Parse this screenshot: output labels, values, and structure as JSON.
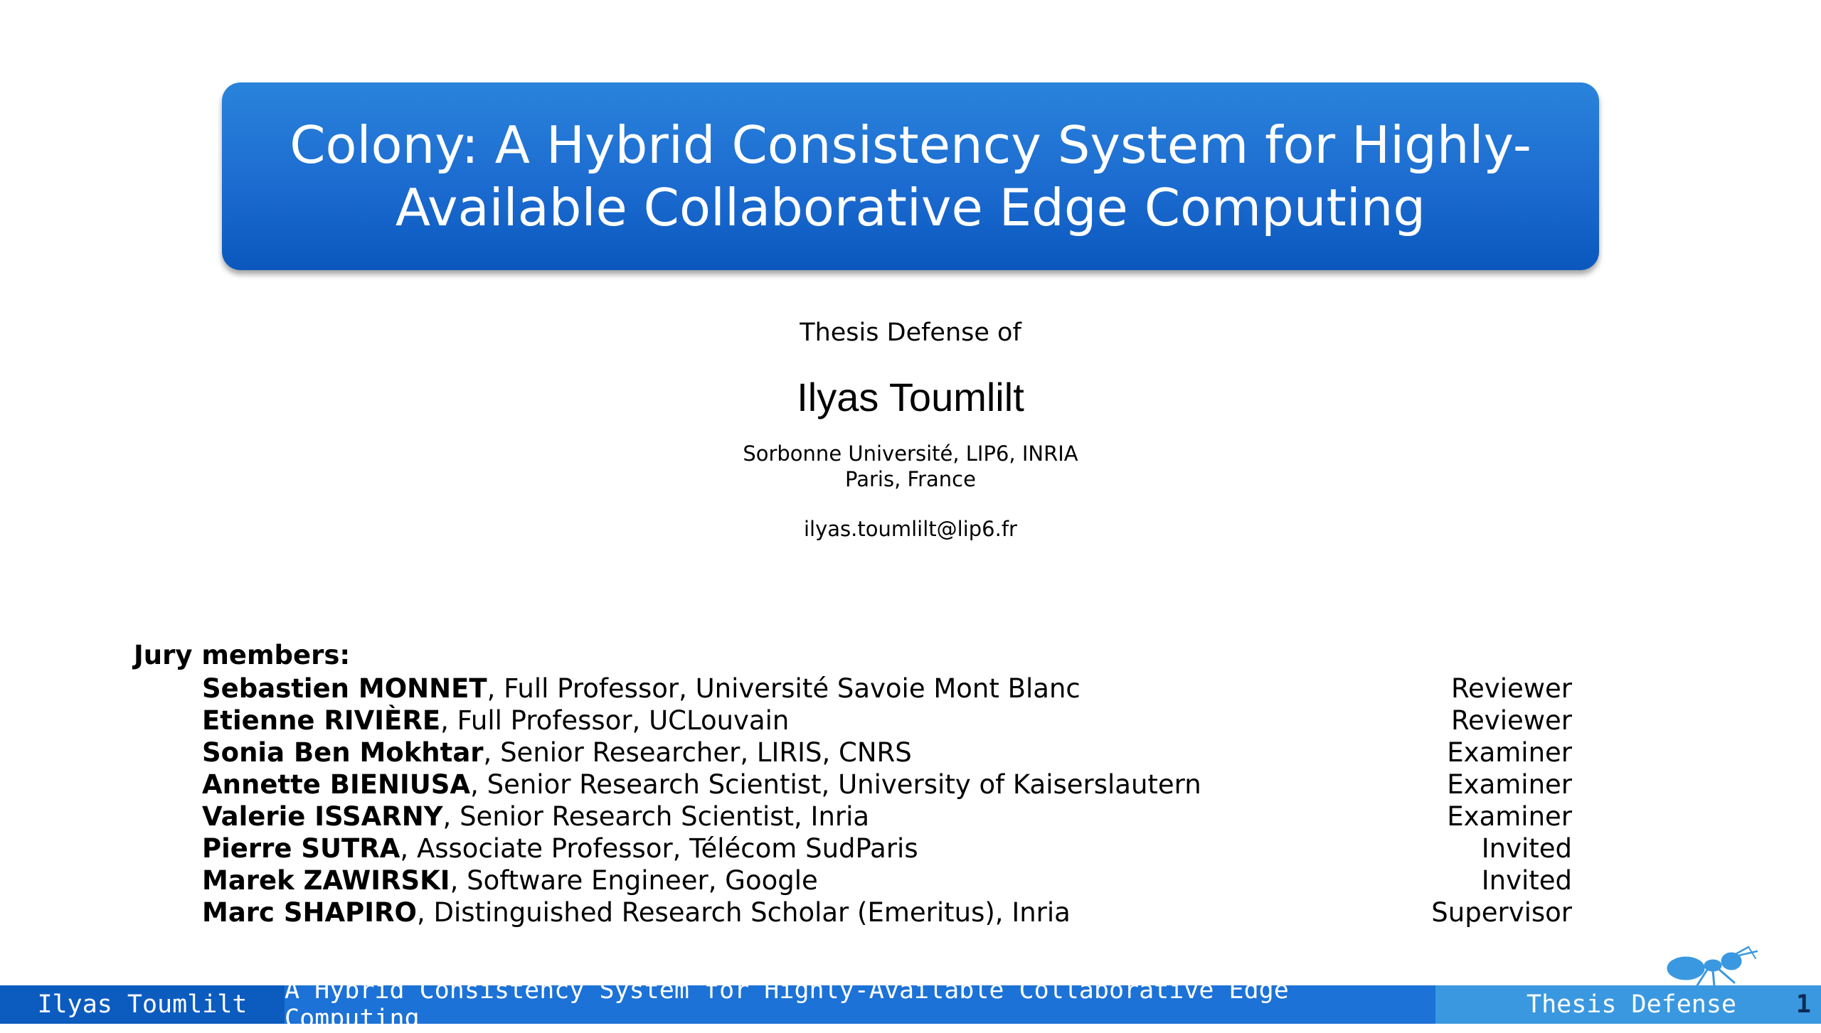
{
  "slide": {
    "title": "Colony: A Hybrid Consistency System for Highly-Available Collaborative Edge Computing",
    "subtitle": "Thesis Defense of",
    "author": "Ilyas Toumlilt",
    "affiliation_line1": "Sorbonne Université, LIP6, INRIA",
    "affiliation_line2": "Paris, France",
    "email": "ilyas.toumlilt@lip6.fr"
  },
  "jury": {
    "heading": "Jury members:",
    "members": [
      {
        "name": "Sebastien MONNET",
        "detail": ", Full Professor, Université Savoie Mont Blanc",
        "role": "Reviewer"
      },
      {
        "name": "Etienne RIVIÈRE",
        "detail": ", Full Professor, UCLouvain",
        "role": "Reviewer"
      },
      {
        "name": "Sonia Ben Mokhtar",
        "detail": ", Senior Researcher, LIRIS, CNRS",
        "role": "Examiner"
      },
      {
        "name": "Annette BIENIUSA",
        "detail": ", Senior Research Scientist, University of Kaiserslautern",
        "role": "Examiner"
      },
      {
        "name": "Valerie ISSARNY",
        "detail": ", Senior Research Scientist, Inria",
        "role": "Examiner"
      },
      {
        "name": "Pierre SUTRA",
        "detail": ", Associate Professor, Télécom SudParis",
        "role": "Invited"
      },
      {
        "name": "Marek ZAWIRSKI",
        "detail": ", Software Engineer, Google",
        "role": "Invited"
      },
      {
        "name": "Marc SHAPIRO",
        "detail": ", Distinguished Research Scholar (Emeritus), Inria",
        "role": "Supervisor"
      }
    ]
  },
  "footer": {
    "author": "Ilyas Toumlilt",
    "short_title": "A Hybrid Consistency System for Highly-Available Collaborative Edge Computing",
    "event": "Thesis Defense",
    "page_number": "1"
  },
  "logo": {
    "icon": "ant-icon",
    "color": "#3a98e0"
  },
  "colors": {
    "title_box": "#1c6bd0",
    "footer_dark": "#0c5bbf",
    "footer_mid": "#1c72d6",
    "footer_light": "#3a98e0"
  }
}
